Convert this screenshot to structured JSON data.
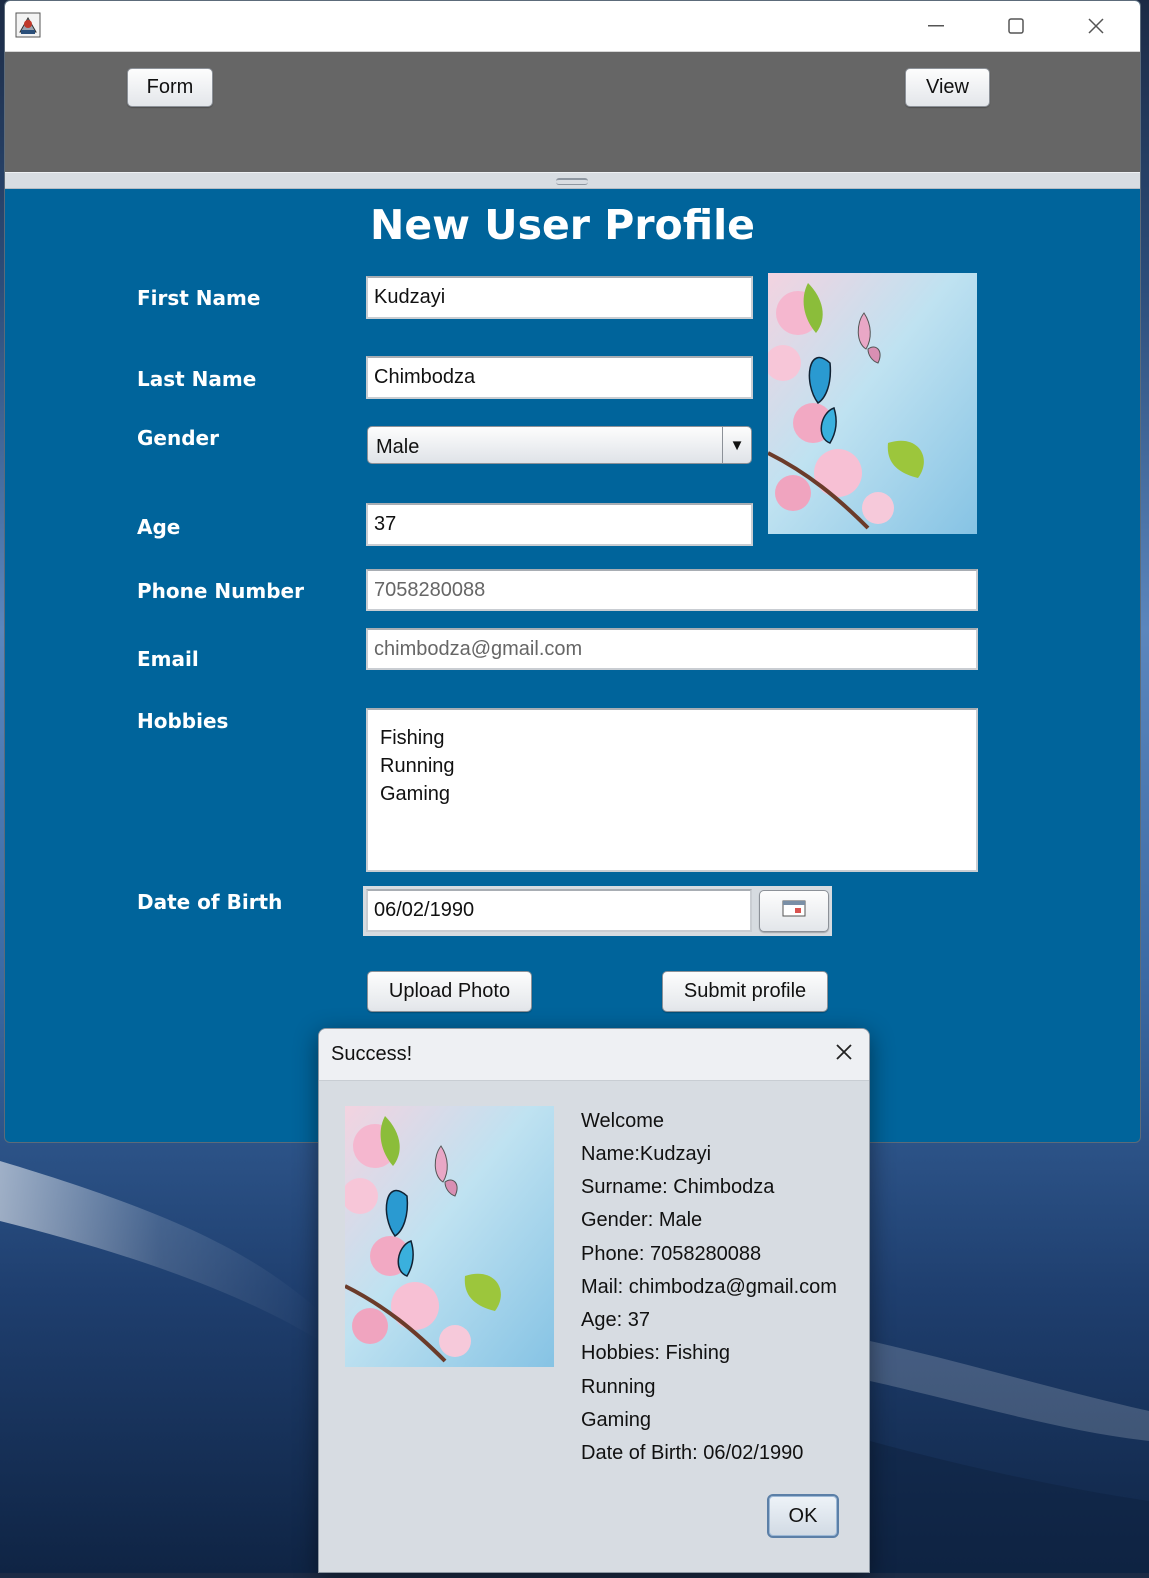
{
  "toolbar": {
    "form_button": "Form",
    "view_button": "View"
  },
  "titlebar": {
    "min_icon": "minimize-icon",
    "max_icon": "maximize-icon",
    "close_icon": "close-icon"
  },
  "form": {
    "title": "New User Profile",
    "labels": {
      "first_name": "First Name",
      "last_name": "Last Name",
      "gender": "Gender",
      "age": "Age",
      "phone": "Phone Number",
      "email": "Email",
      "hobbies": "Hobbies",
      "dob": "Date of Birth"
    },
    "values": {
      "first_name": "Kudzayi",
      "last_name": "Chimbodza",
      "gender": "Male",
      "age": "37",
      "phone": "7058280088",
      "email": "chimbodza@gmail.com",
      "hobbies": [
        "Fishing",
        "Running",
        "Gaming"
      ],
      "dob": "06/02/1990"
    },
    "buttons": {
      "upload": "Upload Photo",
      "submit": "Submit profile"
    }
  },
  "dialog": {
    "title": "Success!",
    "lines": [
      "Welcome",
      "Name:Kudzayi",
      "Surname: Chimbodza",
      "Gender: Male",
      "Phone: 7058280088",
      "Mail: chimbodza@gmail.com",
      "Age: 37",
      "Hobbies: Fishing",
      "Running",
      "Gaming",
      "Date of Birth: 06/02/1990"
    ],
    "ok": "OK"
  },
  "colors": {
    "form_background": "#00649b",
    "top_panel": "#666666",
    "dialog_background": "#d7dce2"
  }
}
